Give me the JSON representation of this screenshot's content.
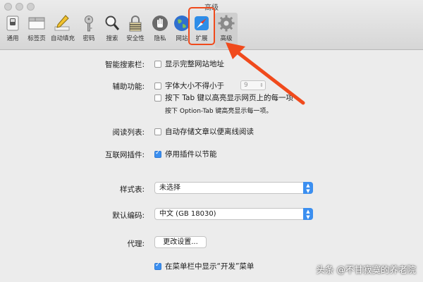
{
  "window": {
    "title": "高级"
  },
  "toolbar": {
    "items": [
      {
        "label": "通用",
        "icon": "general-switch-icon"
      },
      {
        "label": "标签页",
        "icon": "tabs-icon"
      },
      {
        "label": "自动填充",
        "icon": "pencil-icon"
      },
      {
        "label": "密码",
        "icon": "key-icon"
      },
      {
        "label": "搜索",
        "icon": "magnifier-icon"
      },
      {
        "label": "安全性",
        "icon": "lock-icon"
      },
      {
        "label": "隐私",
        "icon": "hand-icon"
      },
      {
        "label": "网站",
        "icon": "globe-icon"
      },
      {
        "label": "扩展",
        "icon": "puzzle-compass-icon"
      },
      {
        "label": "高级",
        "icon": "gear-icon"
      }
    ],
    "active": "高级",
    "highlighted": "扩展",
    "highlight_color": "#f04a1c"
  },
  "settings": {
    "search_field": {
      "label": "智能搜索栏:",
      "option": "显示完整网站地址",
      "checked": false
    },
    "accessibility": {
      "label": "辅助功能:",
      "min_font": {
        "text": "字体大小不得小于",
        "value": "9",
        "checked": false
      },
      "tab_highlight": {
        "text": "按下 Tab 键以高亮显示网页上的每一项",
        "checked": false
      },
      "hint": "按下 Option-Tab 键高亮显示每一项。"
    },
    "reading_list": {
      "label": "阅读列表:",
      "option": "自动存储文章以便离线阅读",
      "checked": false
    },
    "plugins": {
      "label": "互联网插件:",
      "option": "停用插件以节能",
      "checked": true
    },
    "stylesheet": {
      "label": "样式表:",
      "value": "未选择"
    },
    "encoding": {
      "label": "默认编码:",
      "value": "中文 (GB 18030)"
    },
    "proxy": {
      "label": "代理:",
      "button": "更改设置..."
    },
    "develop_menu": {
      "option": "在菜单栏中显示“开发”菜单",
      "checked": true
    }
  },
  "watermark": "头条 @不甘寂寞的养老院",
  "accent_color": "#3b8ff0"
}
